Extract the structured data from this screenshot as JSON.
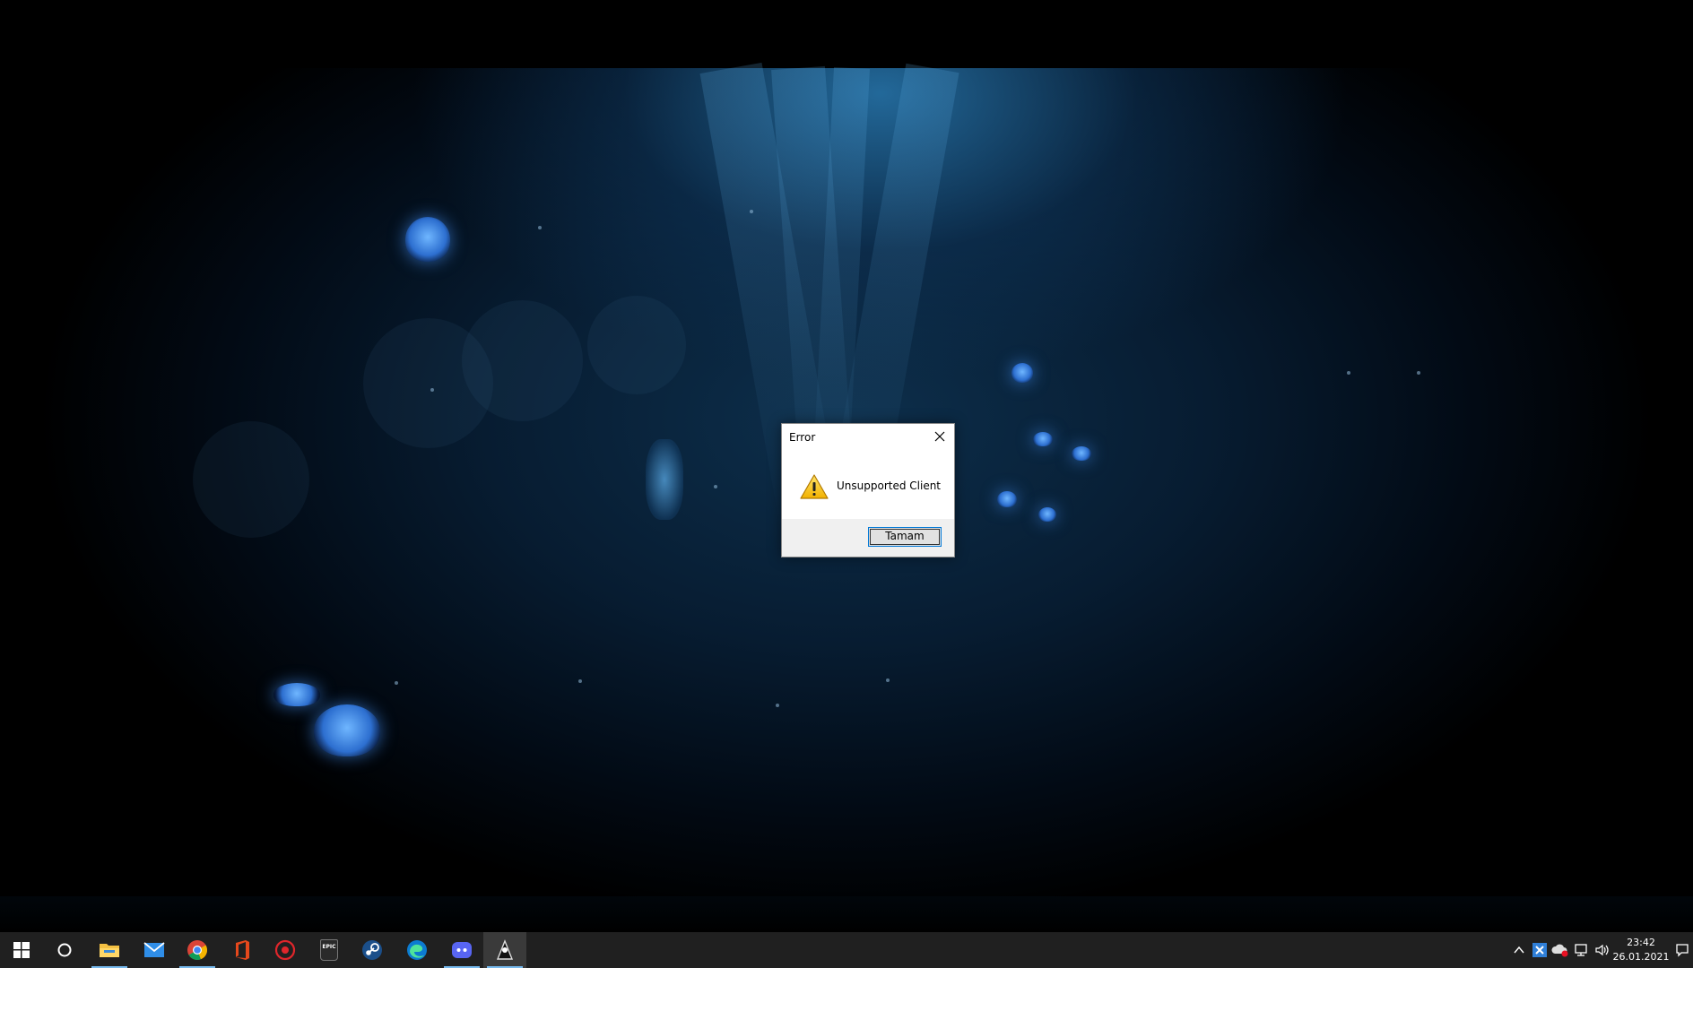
{
  "dialog": {
    "title": "Error",
    "message": "Unsupported Client",
    "ok_label": "Tamam"
  },
  "taskbar": {
    "apps": [
      {
        "name": "file-explorer",
        "active": true
      },
      {
        "name": "mail",
        "active": false
      },
      {
        "name": "chrome",
        "active": true
      },
      {
        "name": "office",
        "active": false
      },
      {
        "name": "game-launcher",
        "active": false
      },
      {
        "name": "epic-games",
        "active": false
      },
      {
        "name": "steam",
        "active": false
      },
      {
        "name": "edge",
        "active": false
      },
      {
        "name": "discord",
        "active": true
      },
      {
        "name": "game-client",
        "active": true
      }
    ],
    "epic_label": "EPIC",
    "clock": {
      "time": "23:42",
      "date": "26.01.2021"
    }
  },
  "colors": {
    "taskbar": "#202020",
    "accent": "#0078d7",
    "active_indicator": "#76b9ed"
  }
}
